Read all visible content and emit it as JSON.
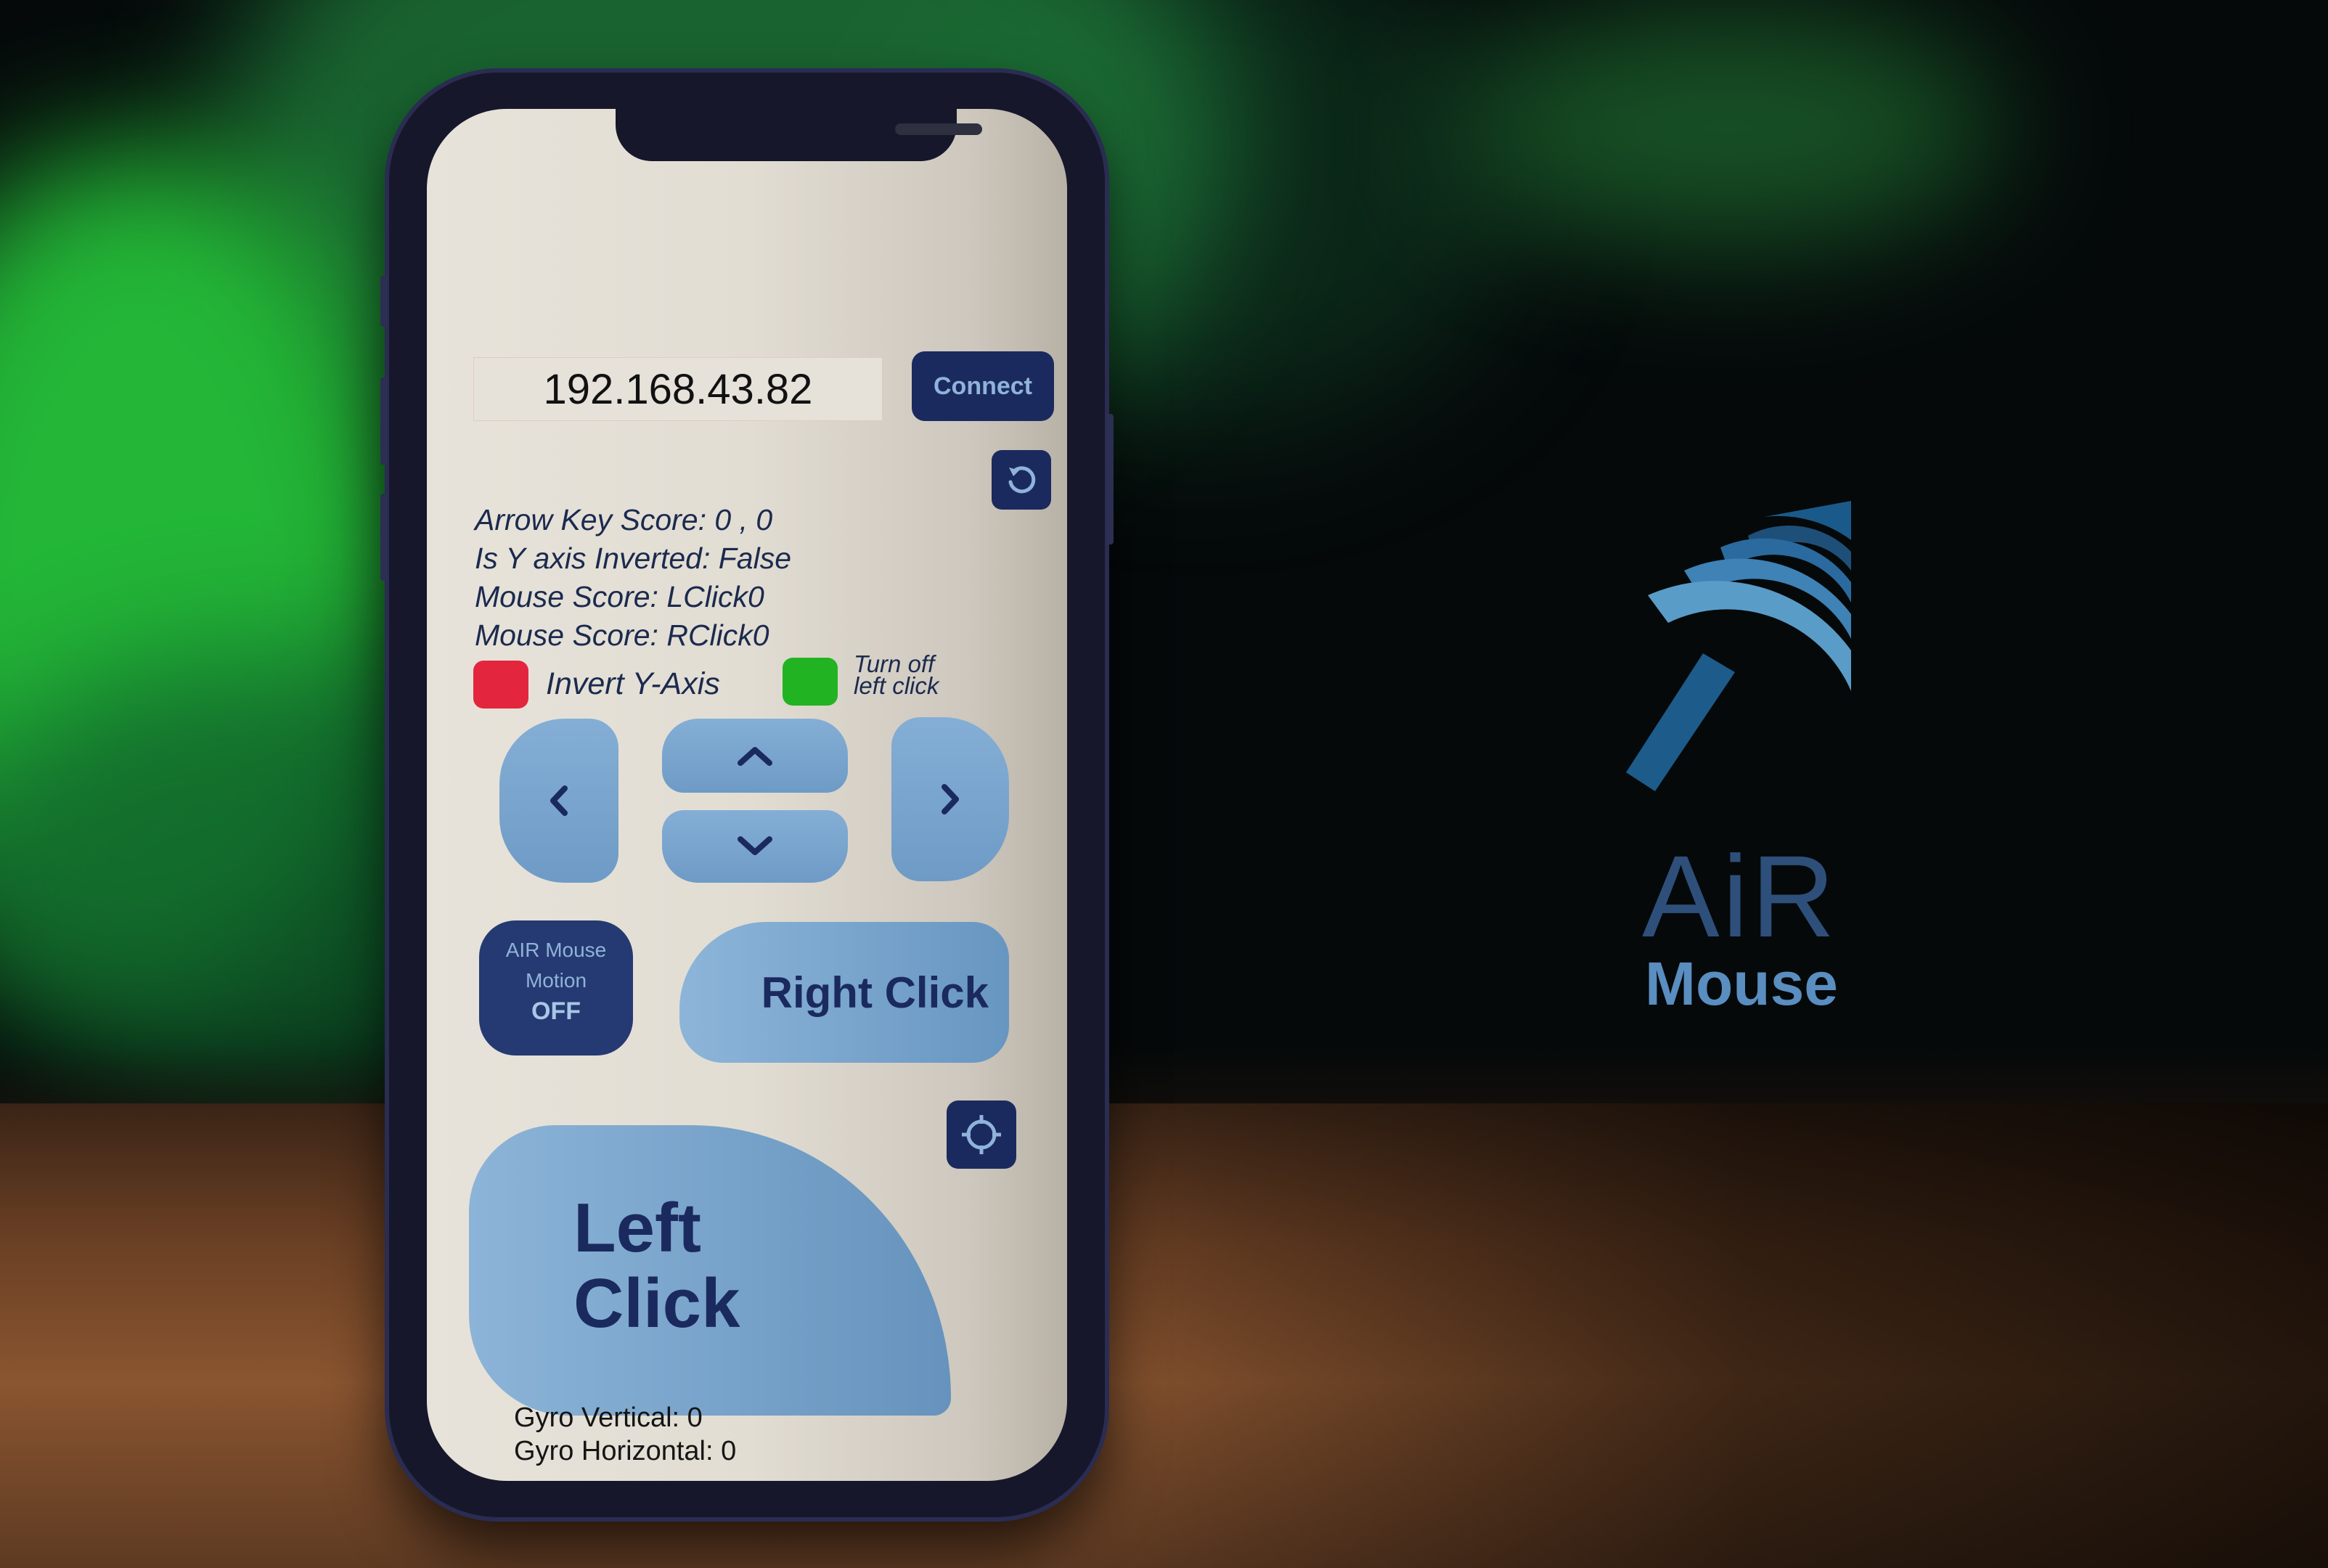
{
  "connection": {
    "ip_value": "192.168.43.82",
    "connect_label": "Connect"
  },
  "info": {
    "arrow_key_score": "Arrow Key Score: 0 , 0",
    "y_inverted": "Is Y axis Inverted: False",
    "mouse_lclick": "Mouse Score: LClick0",
    "mouse_rclick": "Mouse Score: RClick0"
  },
  "toggles": {
    "invert_label": "Invert Y-Axis",
    "invert_color": "#e3263e",
    "turn_off_line1": "Turn off",
    "turn_off_line2": "left click",
    "turn_off_color": "#22b322"
  },
  "motion": {
    "line1": "AIR Mouse",
    "line2": "Motion",
    "state": "OFF"
  },
  "buttons": {
    "right_click": "Right Click",
    "left_click_line1": "Left",
    "left_click_line2": "Click"
  },
  "gyro": {
    "vertical": "Gyro Vertical: 0",
    "horizontal": "Gyro Horizontal: 0"
  },
  "brand": {
    "line1": "AiR",
    "line2": "Mouse"
  },
  "colors": {
    "accent_dark": "#1b2a5e",
    "accent_light": "#84aed5"
  }
}
